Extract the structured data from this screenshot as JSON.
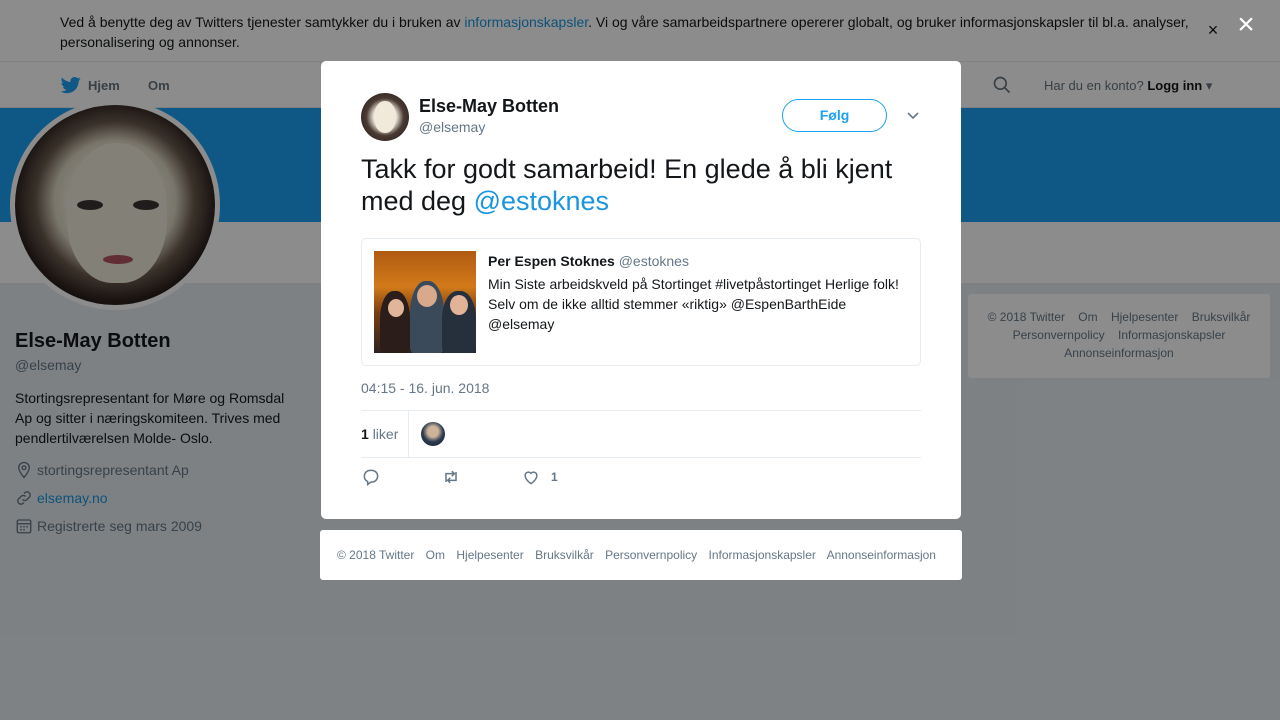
{
  "cookie": {
    "text_before": "Ved å benytte deg av Twitters tjenester samtykker du i bruken av ",
    "link": "informasjonskapsler",
    "text_after": ". Vi og våre samarbeidspartnere opererer globalt, og bruker informasjonskapsler til bl.a. analyser, personalisering og annonser.",
    "close": "×"
  },
  "nav": {
    "home": "Hjem",
    "about": "Om",
    "account_prompt": "Har du en konto?",
    "login": "Logg inn"
  },
  "profile": {
    "name": "Else-May Botten",
    "handle": "@elsemay",
    "bio": "Stortingsrepresentant for Møre og Romsdal Ap og sitter i næringskomiteen. Trives med pendlertilværelsen Molde- Oslo.",
    "location": "stortingsrepresentant Ap",
    "website": "elsemay.no",
    "joined": "Registrerte seg mars 2009"
  },
  "side_footer": {
    "links": [
      "© 2018 Twitter",
      "Om",
      "Hjelpesenter",
      "Bruksvilkår",
      "Personvernpolicy",
      "Informasjonskapsler",
      "Annonseinformasjon"
    ]
  },
  "overlay_close": "×",
  "tweet": {
    "author_name": "Else-May Botten",
    "author_handle": "@elsemay",
    "follow_label": "Følg",
    "text": "Takk for godt samarbeid! En glede å bli kjent med deg ",
    "mention": "@estoknes",
    "quote": {
      "name": "Per Espen Stoknes",
      "handle": "@estoknes",
      "text": "Min Siste arbeidskveld på Stortinget #livetpåstortinget Herlige folk! Selv om de ikke alltid stemmer «riktig» @EspenBarthEide @elsemay"
    },
    "timestamp": "04:15 - 16. jun. 2018",
    "likes_count": "1",
    "likes_label": "liker",
    "like_action_count": "1"
  },
  "modal_footer": {
    "links": [
      "© 2018 Twitter",
      "Om",
      "Hjelpesenter",
      "Bruksvilkår",
      "Personvernpolicy",
      "Informasjonskapsler",
      "Annonseinformasjon"
    ]
  },
  "colors": {
    "brand": "#1da1f2",
    "link": "#1b95e0",
    "muted": "#657786",
    "overlay": "rgba(0,0,0,0.45)"
  },
  "icons": [
    "twitter-bird-icon",
    "search-icon",
    "caret-down-icon",
    "location-icon",
    "link-icon",
    "calendar-icon",
    "reply-icon",
    "retweet-icon",
    "heart-icon",
    "close-icon",
    "chevron-down-icon"
  ]
}
